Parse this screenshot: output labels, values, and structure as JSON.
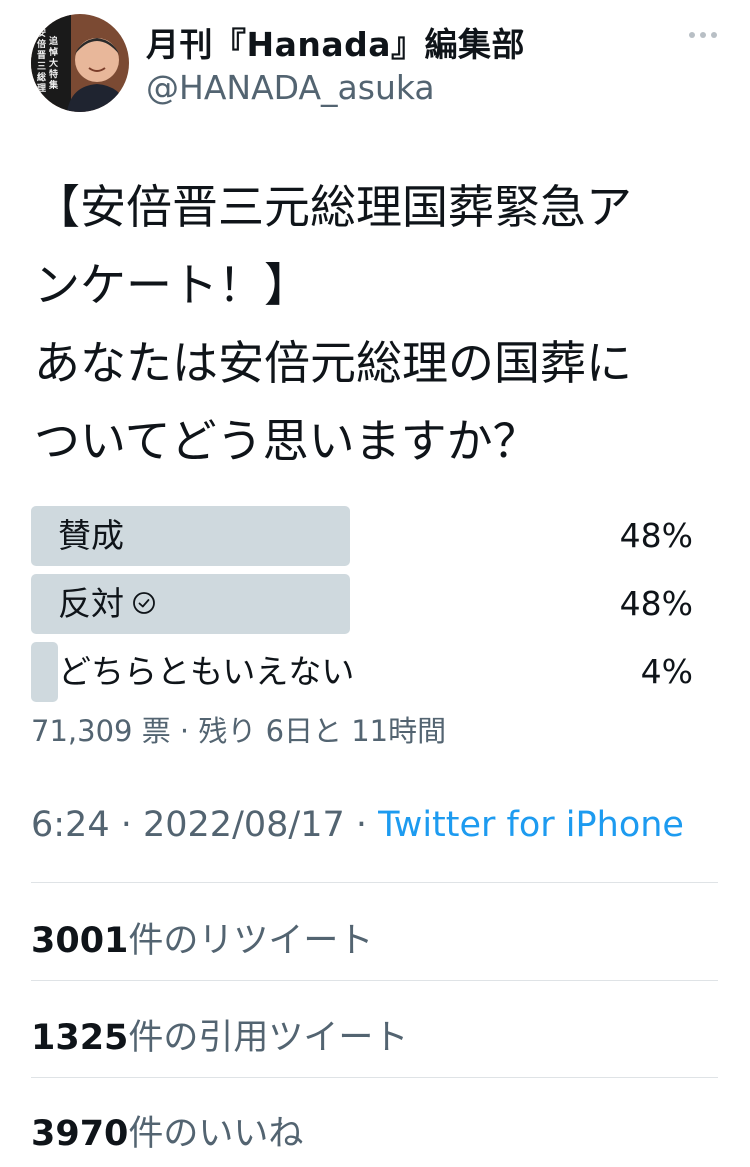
{
  "header": {
    "display_name": "月刊『Hanada』編集部",
    "handle": "@HANADA_asuka",
    "avatar_text": "安倍晋三総理追悼大特集"
  },
  "tweet": {
    "lines": [
      "【安倍晋三元総理国葬緊急ア",
      "ンケート！】",
      "あなたは安倍元総理の国葬に",
      "ついてどう思いますか？"
    ]
  },
  "poll": {
    "options": [
      {
        "label": "賛成",
        "percent_text": "48%",
        "percent": 48
      },
      {
        "label": "反対",
        "percent_text": "48%",
        "percent": 48,
        "voted": true
      },
      {
        "label": "どちらともいえない",
        "percent_text": "4%",
        "percent": 4
      }
    ],
    "meta": "71,309 票 · 残り 6日と 11時間"
  },
  "tweet_meta": {
    "time": "6:24",
    "date": "2022/08/17",
    "source": "Twitter for iPhone"
  },
  "stats": {
    "retweets": {
      "count": "3001",
      "label": "件のリツイート"
    },
    "quotes": {
      "count": "1325",
      "label": "件の引用ツイート"
    },
    "likes": {
      "count": "3970",
      "label": "件のいいね"
    }
  },
  "colors": {
    "text": "#0f1419",
    "secondary": "#536471",
    "link": "#1d9bf0",
    "poll_bar": "#cfd9de"
  },
  "icons": {
    "more": "more-horizontal-icon",
    "voted": "check-circle-icon"
  }
}
